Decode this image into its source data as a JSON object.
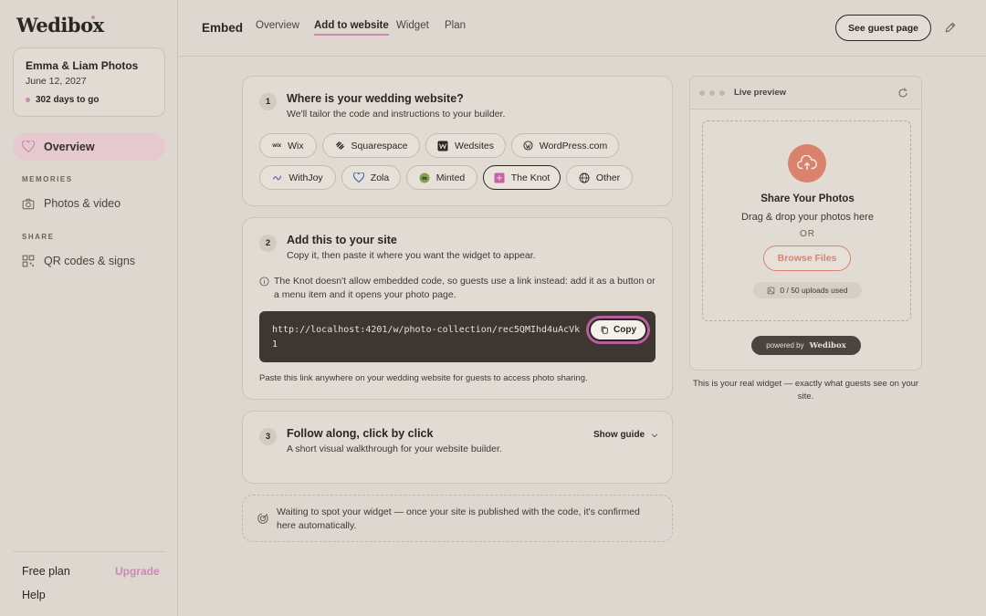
{
  "sidebar": {
    "logo": "Wedibox",
    "event": {
      "title": "Emma & Liam Photos",
      "date": "June 12, 2027",
      "countdown": "302 days to go"
    },
    "nav_overview": "Overview",
    "memories_label": "MEMORIES",
    "photos_video": "Photos & video",
    "share_label": "SHARE",
    "qr_codes": "QR codes & signs",
    "free_plan": "Free plan",
    "upgrade": "Upgrade",
    "help": "Help"
  },
  "header": {
    "title": "Embed",
    "tabs": [
      {
        "label": "Overview"
      },
      {
        "label": "Add to website"
      },
      {
        "label": "Widget"
      },
      {
        "label": "Plan"
      }
    ],
    "guest_button": "See guest page"
  },
  "step1": {
    "num": "1",
    "title": "Where is your wedding website?",
    "subtitle": "We'll tailor the code and instructions to your builder.",
    "builders": [
      {
        "label": "Wix"
      },
      {
        "label": "Squarespace"
      },
      {
        "label": "Wedsites"
      },
      {
        "label": "WordPress.com"
      },
      {
        "label": "WithJoy"
      },
      {
        "label": "Zola"
      },
      {
        "label": "Minted"
      },
      {
        "label": "The Knot"
      },
      {
        "label": "Other"
      }
    ],
    "selected": "The Knot"
  },
  "step2": {
    "num": "2",
    "title": "Add this to your site",
    "subtitle": "Copy it, then paste it where you want the widget to appear.",
    "info": "The Knot doesn't allow embedded code, so guests use a link instead: add it as a button or a menu item and it opens your photo page.",
    "code": "http://localhost:4201/w/photo-collection/rec5QMIhd4uAcVk1",
    "copy_label": "Copy",
    "paste_note": "Paste this link anywhere on your wedding website for guests to access photo sharing."
  },
  "step3": {
    "num": "3",
    "title": "Follow along, click by click",
    "subtitle": "A short visual walkthrough for your website builder.",
    "show_guide": "Show guide"
  },
  "waiting": {
    "text": "Waiting to spot your widget — once your site is published with the code, it's confirmed here automatically."
  },
  "preview": {
    "title": "Live preview",
    "share_title": "Share Your Photos",
    "share_sub": "Drag & drop your photos here",
    "or": "OR",
    "browse": "Browse Files",
    "uploads": "0 / 50 uploads used",
    "powered_by": "powered by",
    "powered_brand": "Wedibox",
    "caption": "This is your real widget — exactly what guests see on your site."
  },
  "colors": {
    "background": "#ddd7cf",
    "accent_pink": "#c98ab3",
    "accent_orange": "#d9836c",
    "code_bg": "#3d3632"
  }
}
